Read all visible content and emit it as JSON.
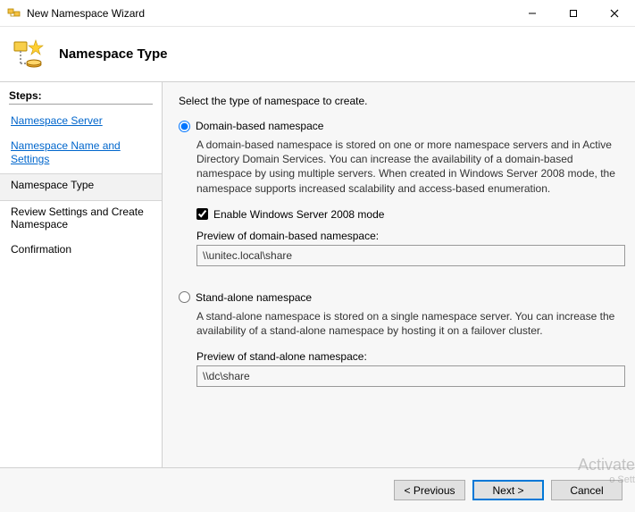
{
  "window": {
    "title": "New Namespace Wizard"
  },
  "banner": {
    "heading": "Namespace Type"
  },
  "sidebar": {
    "header": "Steps:",
    "items": [
      {
        "label": "Namespace Server",
        "current": false
      },
      {
        "label": "Namespace Name and Settings",
        "current": false
      },
      {
        "label": "Namespace Type",
        "current": true
      },
      {
        "label": "Review Settings and Create Namespace",
        "current": false
      },
      {
        "label": "Confirmation",
        "current": false
      }
    ]
  },
  "content": {
    "intro": "Select the type of namespace to create.",
    "domain": {
      "radio_label": "Domain-based namespace",
      "description": "A domain-based namespace is stored on one or more namespace servers and in Active Directory Domain Services. You can increase the availability of a domain-based namespace by using multiple servers. When created in Windows Server 2008 mode, the namespace supports increased scalability and access-based enumeration.",
      "checkbox_label": "Enable Windows Server 2008 mode",
      "checkbox_checked": true,
      "preview_label": "Preview of domain-based namespace:",
      "preview_value": "\\\\unitec.local\\share",
      "selected": true
    },
    "standalone": {
      "radio_label": "Stand-alone namespace",
      "description": "A stand-alone namespace is stored on a single namespace server. You can increase the availability of a stand-alone namespace by hosting it on a failover cluster.",
      "preview_label": "Preview of stand-alone namespace:",
      "preview_value": "\\\\dc\\share",
      "selected": false
    }
  },
  "footer": {
    "previous": "< Previous",
    "next": "Next >",
    "cancel": "Cancel"
  },
  "watermark": {
    "line1": "Activate",
    "line2": "o Sett"
  }
}
